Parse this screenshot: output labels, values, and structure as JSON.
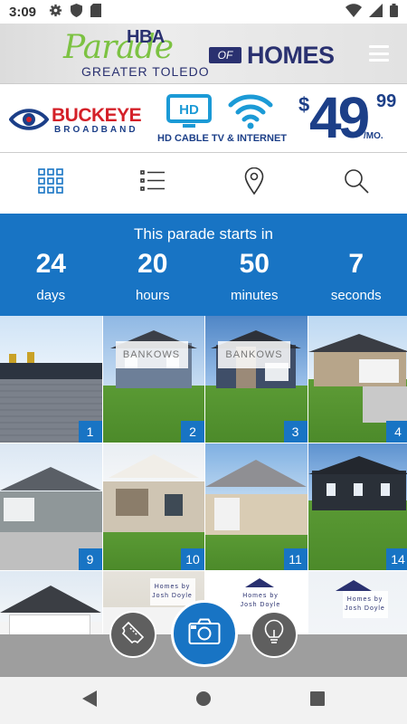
{
  "status_bar": {
    "time": "3:09"
  },
  "header": {
    "logo": {
      "top": "HBA",
      "script": "Parade",
      "of": "OF",
      "homes": "HOMES",
      "region": "GREATER TOLEDO"
    }
  },
  "ad": {
    "brand": "BUCKEYE",
    "brand_sub": "BROADBAND",
    "hd": "HD",
    "tagline": "HD CABLE TV & INTERNET",
    "price_dollar": "$",
    "price_main": "49",
    "price_cents": "99",
    "price_unit": "/MO."
  },
  "toolbar": {
    "icons": [
      "grid-view-icon",
      "list-view-icon",
      "map-pin-icon",
      "search-icon"
    ]
  },
  "countdown": {
    "title": "This parade starts in",
    "units": [
      {
        "value": "24",
        "label": "days"
      },
      {
        "value": "20",
        "label": "hours"
      },
      {
        "value": "50",
        "label": "minutes"
      },
      {
        "value": "7",
        "label": "seconds"
      }
    ]
  },
  "homes": [
    {
      "number": "1",
      "sign": ""
    },
    {
      "number": "2",
      "sign": "BANKOWS"
    },
    {
      "number": "3",
      "sign": "BANKOWS"
    },
    {
      "number": "4",
      "sign": ""
    },
    {
      "number": "9",
      "sign": ""
    },
    {
      "number": "10",
      "sign": ""
    },
    {
      "number": "11",
      "sign": ""
    },
    {
      "number": "14",
      "sign": ""
    },
    {
      "number": "",
      "sign": ""
    },
    {
      "number": "",
      "sign": "Homes by Josh Doyle"
    },
    {
      "number": "",
      "sign": "Homes by Josh Doyle"
    },
    {
      "number": "",
      "sign": "Homes by Josh Doyle"
    }
  ],
  "colors": {
    "accent": "#1874c4",
    "logo_green": "#7cc242",
    "logo_navy": "#2a3170",
    "ad_red": "#d42028",
    "ad_blue": "#1c3f88"
  }
}
